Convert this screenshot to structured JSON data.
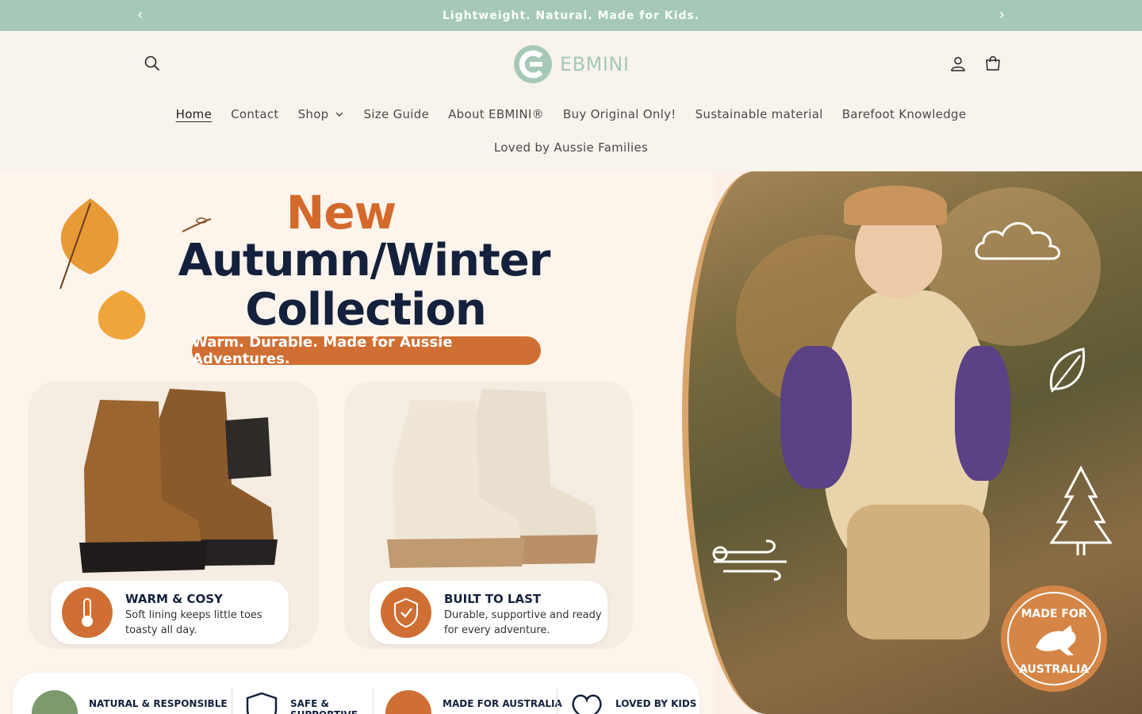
{
  "announcement": {
    "text": "Lightweight. Natural. Made for Kids."
  },
  "header": {
    "logo_text": "EBMINI"
  },
  "nav": {
    "items": [
      {
        "label": "Home"
      },
      {
        "label": "Contact"
      },
      {
        "label": "Shop"
      },
      {
        "label": "Size Guide"
      },
      {
        "label": "About EBMINI®"
      },
      {
        "label": "Buy Original Only!"
      },
      {
        "label": "Sustainable material"
      },
      {
        "label": "Barefoot Knowledge"
      }
    ],
    "second_row": "Loved by Aussie Families"
  },
  "hero": {
    "new": "New",
    "title_line1": "Autumn/Winter",
    "title_line2": "Collection",
    "tagline": "Warm. Durable. Made for Aussie Adventures.",
    "card1": {
      "title": "WARM & COSY",
      "desc": "Soft lining keeps little toes toasty all day."
    },
    "card2": {
      "title": "BUILT TO LAST",
      "desc": "Durable, supportive and ready for every adventure."
    },
    "features": [
      {
        "label": "NATURAL & RESPONSIBLE"
      },
      {
        "label": "SAFE & SUPPORTIVE"
      },
      {
        "label": "MADE FOR AUSTRALIA"
      },
      {
        "label": "LOVED BY KIDS"
      }
    ],
    "stamp_top": "MADE FOR",
    "stamp_bottom": "AUSTRALIA"
  },
  "colors": {
    "announce_bg": "#a5c9b6",
    "accent": "#d06f33",
    "navy": "#14213d",
    "page_bg": "#f8f3ec"
  }
}
